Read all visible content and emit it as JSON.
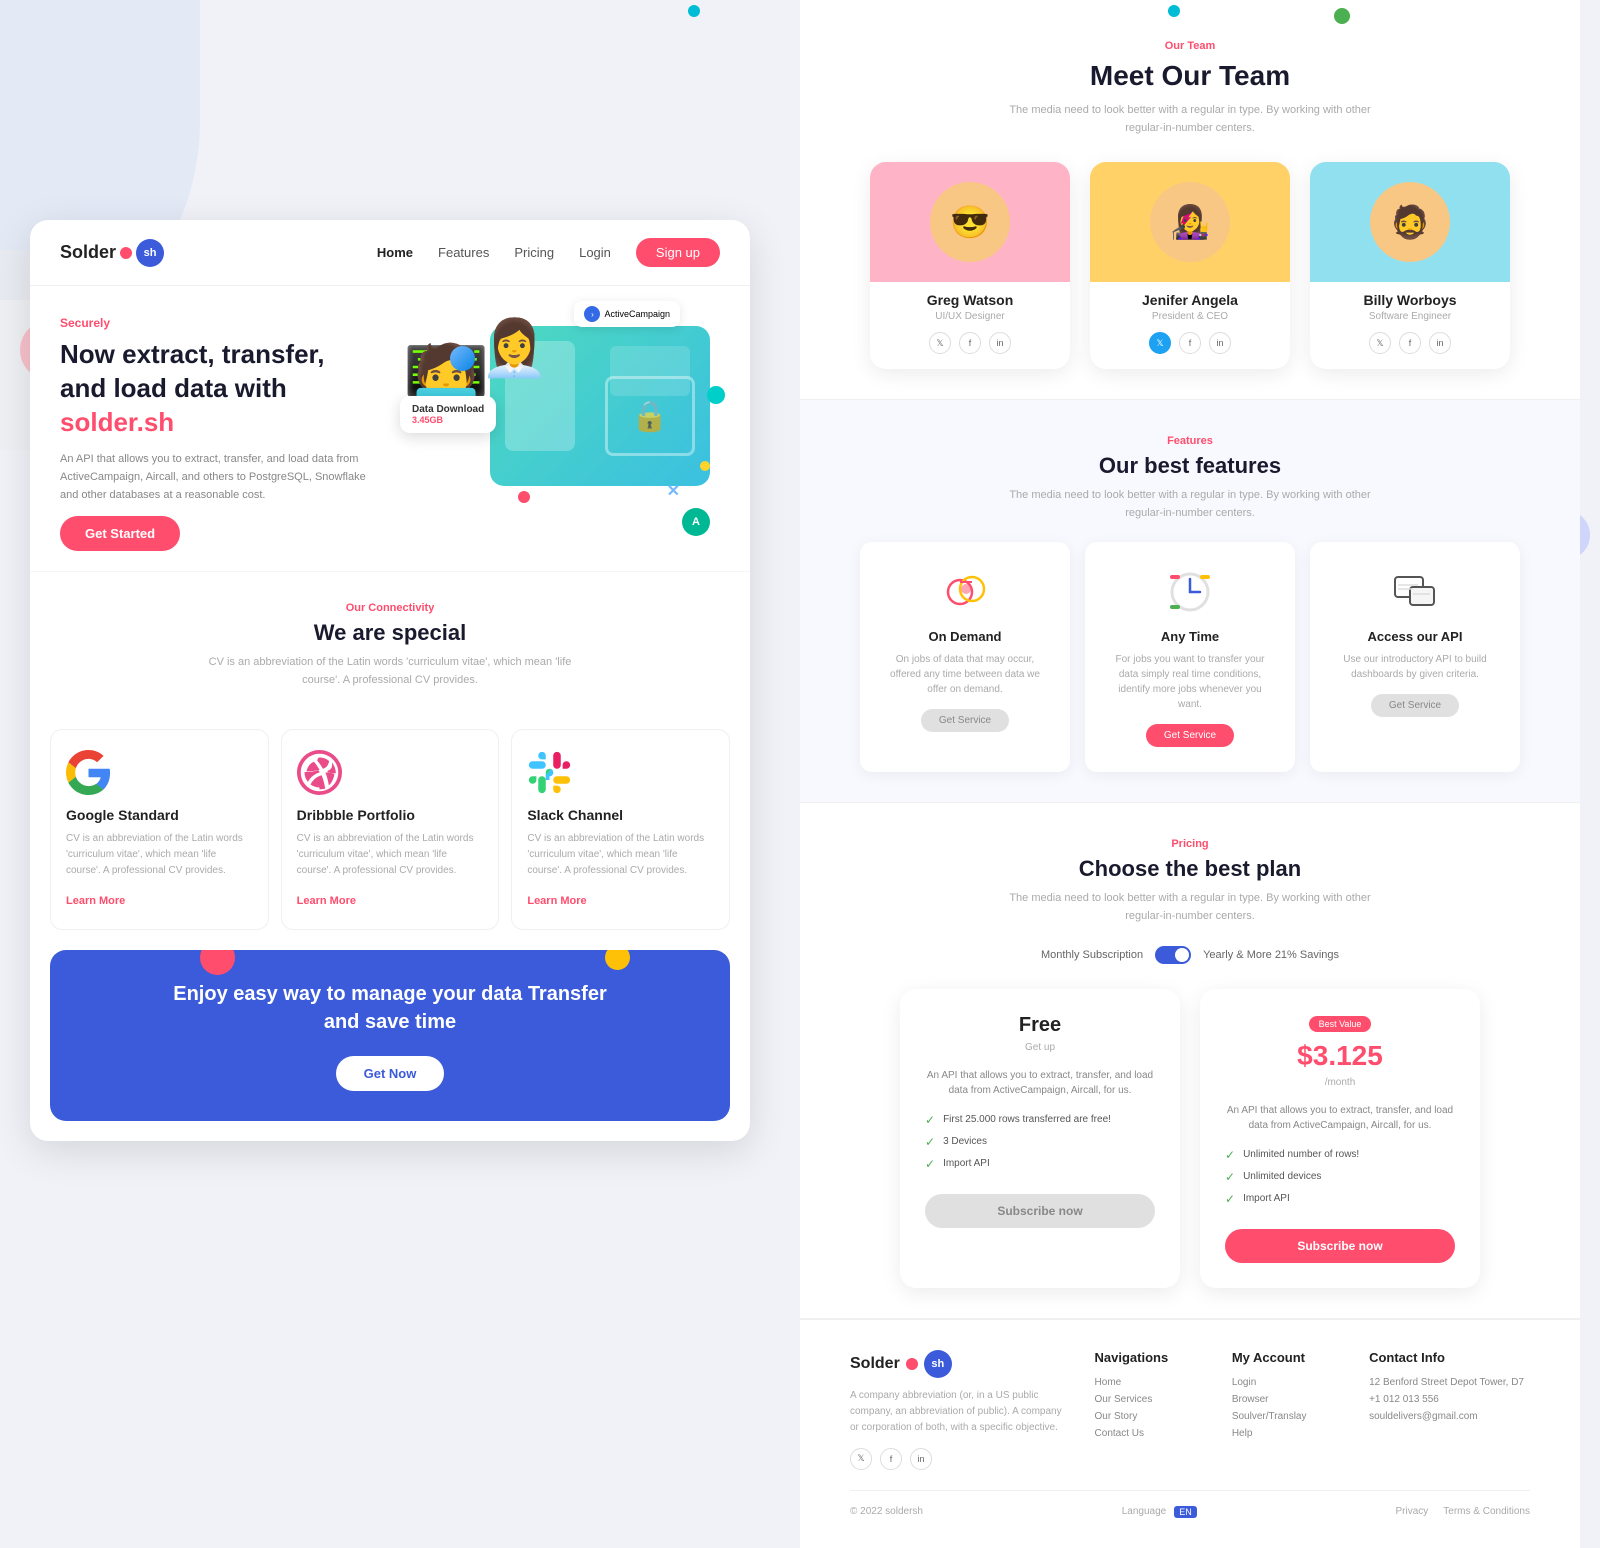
{
  "background": {
    "color": "#f0f2f8"
  },
  "left_panel": {
    "navbar": {
      "logo_text": "Solder",
      "logo_suffix": "sh",
      "links": [
        "Home",
        "Features",
        "Pricing",
        "Login"
      ],
      "signup_label": "Sign up"
    },
    "hero": {
      "label": "Securely",
      "title_line1": "Now extract, transfer,",
      "title_line2": "and load data with",
      "brand": "solder.sh",
      "description": "An API that allows you to extract, transfer, and load data from ActiveCampaign, Aircall, and others to PostgreSQL, Snowflake and other databases at a reasonable cost.",
      "cta_label": "Get Started"
    },
    "illustration": {
      "card_label": "Data Download",
      "card_size": "3.45GB",
      "campaign_label": "ActiveCampaign"
    },
    "connectivity": {
      "section_label": "Our Connectivity",
      "title": "We are special",
      "description": "CV is an abbreviation of the Latin words 'curriculum vitae', which mean 'life course'. A professional CV provides."
    },
    "cards": [
      {
        "icon": "google",
        "title": "Google Standard",
        "description": "CV is an abbreviation of the Latin words 'curriculum vitae', which mean 'life course'. A professional CV provides.",
        "link": "Learn More"
      },
      {
        "icon": "dribbble",
        "title": "Dribbble Portfolio",
        "description": "CV is an abbreviation of the Latin words 'curriculum vitae', which mean 'life course'. A professional CV provides.",
        "link": "Learn More"
      },
      {
        "icon": "slack",
        "title": "Slack Channel",
        "description": "CV is an abbreviation of the Latin words 'curriculum vitae', which mean 'life course'. A professional CV provides.",
        "link": "Learn More"
      }
    ],
    "cta_banner": {
      "title_line1": "Enjoy easy way to manage your data Transfer",
      "title_line2": "and save time",
      "cta_label": "Get Now"
    }
  },
  "right_panel": {
    "team": {
      "section_label": "Our Team",
      "title": "Meet Our Team",
      "description": "The media need to look better with a regular in type. By working with other regular-in-number centers.",
      "members": [
        {
          "name": "Greg Watson",
          "role": "UI/UX Designer",
          "avatar": "👨",
          "avatar_color": "pink"
        },
        {
          "name": "Jenifer Angela",
          "role": "President & CEO",
          "avatar": "👩",
          "avatar_color": "yellow"
        },
        {
          "name": "Billy Worboys",
          "role": "Software Engineer",
          "avatar": "🧔",
          "avatar_color": "cyan"
        }
      ],
      "social_icons": [
        "t",
        "f",
        "in"
      ]
    },
    "features": {
      "section_label": "Features",
      "title": "Our best features",
      "description": "The media need to look better with a regular in type. By working with other regular-in-number centers.",
      "items": [
        {
          "title": "On Demand",
          "description": "On jobs of data that may occur, offered any time between data we offer on demand.",
          "btn_label": "Get Service",
          "btn_style": "gray"
        },
        {
          "title": "Any Time",
          "description": "For jobs you want to transfer your data simply real time conditions, identify more jobs whenever you want.",
          "btn_label": "Get Service",
          "btn_style": "red"
        },
        {
          "title": "Access our API",
          "description": "Use our introductory API to build dashboards by given criteria.",
          "btn_label": "Get Service",
          "btn_style": "gray"
        }
      ]
    },
    "pricing": {
      "section_label": "Pricing",
      "title": "Choose the best plan",
      "description": "The media need to look better with a regular in type. By working with other regular-in-number centers.",
      "toggle_monthly": "Monthly Subscription",
      "toggle_yearly": "Yearly & More 21% Savings",
      "plans": [
        {
          "name": "Free",
          "sub": "Get up",
          "description": "An API that allows you to extract, transfer, and load data from ActiveCampaign, Aircall, for us.",
          "features": [
            "First 25.000 rows transferred are free!",
            "3 Devices",
            "Import API"
          ],
          "btn_label": "Subscribe now",
          "btn_style": "gray",
          "badge": ""
        },
        {
          "name": "$3.125",
          "sub": "/month",
          "description": "An API that allows you to extract, transfer, and load data from ActiveCampaign, Aircall, for us.",
          "features": [
            "Unlimited number of rows!",
            "Unlimited devices",
            "Import API"
          ],
          "btn_label": "Subscribe now",
          "btn_style": "red",
          "badge": "Best Value"
        }
      ]
    },
    "footer": {
      "logo_text": "Solder",
      "logo_suffix": "sh",
      "description": "A company abbreviation (or, in a US public company, an abbreviation of public). A company or corporation of both, with a specific objective.",
      "social_icons": [
        "t",
        "f",
        "in"
      ],
      "nav_heading": "Navigations",
      "nav_links": [
        "Home",
        "Our Services",
        "Our Story",
        "Contact Us"
      ],
      "account_heading": "My Account",
      "account_links": [
        "Login",
        "Browser",
        "Soulver/Translay",
        "Help"
      ],
      "contact_heading": "Contact Info",
      "contact_address": "12 Benford Street Depot Tower, D7",
      "contact_phone": "+1 012 013 556",
      "contact_email": "souldelivers@gmail.com",
      "copyright": "© 2022 soldersh",
      "language_label": "Language",
      "language_value": "EN",
      "privacy_links": [
        "Privacy",
        "Terms & Conditions"
      ]
    }
  }
}
